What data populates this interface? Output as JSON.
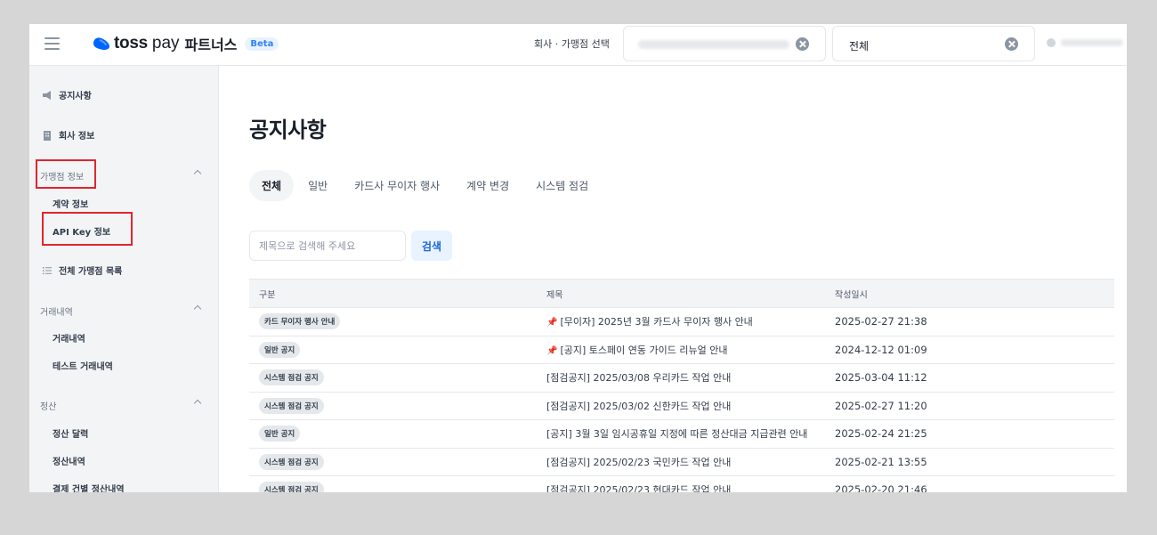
{
  "header": {
    "logo_brand": "toss",
    "logo_pay": "pay",
    "logo_partners": "파트너스",
    "beta_label": "Beta",
    "select_label": "회사 · 가맹점 선택",
    "store_select_value": "전체"
  },
  "sidebar": {
    "notice": "공지사항",
    "company_info": "회사 정보",
    "store_info_group": "가맹점 정보",
    "contract_info": "계약 정보",
    "api_key_info": "API Key 정보",
    "all_stores": "전체 가맹점 목록",
    "transactions_group": "거래내역",
    "transactions": "거래내역",
    "test_transactions": "테스트 거래내역",
    "settlement_group": "정산",
    "settlement_calendar": "정산 달력",
    "settlement_history": "정산내역",
    "payment_settlement": "결제 건별 정산내역"
  },
  "main": {
    "title": "공지사항",
    "tabs": [
      {
        "label": "전체"
      },
      {
        "label": "일반"
      },
      {
        "label": "카드사 무이자 행사"
      },
      {
        "label": "계약 변경"
      },
      {
        "label": "시스템 점검"
      }
    ],
    "search": {
      "placeholder": "제목으로 검색해 주세요",
      "button": "검색"
    },
    "table": {
      "headers": [
        "구분",
        "제목",
        "작성일시"
      ],
      "rows": [
        {
          "category": "카드 무이자 행사 안내",
          "pinned": true,
          "title": "[무이자] 2025년 3월 카드사 무이자 행사 안내",
          "date": "2025-02-27 21:38"
        },
        {
          "category": "일반 공지",
          "pinned": true,
          "title": "[공지] 토스페이 연동 가이드 리뉴얼 안내",
          "date": "2024-12-12 01:09"
        },
        {
          "category": "시스템 점검 공지",
          "pinned": false,
          "title": "[점검공지] 2025/03/08 우리카드 작업 안내",
          "date": "2025-03-04 11:12"
        },
        {
          "category": "시스템 점검 공지",
          "pinned": false,
          "title": "[점검공지] 2025/03/02 신한카드 작업 안내",
          "date": "2025-02-27 11:20"
        },
        {
          "category": "일반 공지",
          "pinned": false,
          "title": "[공지] 3월 3일 임시공휴일 지정에 따른 정산대금 지급관련 안내",
          "date": "2025-02-24 21:25"
        },
        {
          "category": "시스템 점검 공지",
          "pinned": false,
          "title": "[점검공지] 2025/02/23 국민카드 작업 안내",
          "date": "2025-02-21 13:55"
        },
        {
          "category": "시스템 점검 공지",
          "pinned": false,
          "title": "[점검공지] 2025/02/23 현대카드 작업 안내",
          "date": "2025-02-20 21:46"
        }
      ]
    }
  },
  "colors": {
    "accent": "#3182f6",
    "highlight_box": "#e0252f",
    "sidebar_bg": "#f2f4f6"
  },
  "icons": [
    "hamburger-icon",
    "toss-logo-icon",
    "clear-icon",
    "user-icon",
    "megaphone-icon",
    "building-icon",
    "list-icon",
    "chevron-up-icon",
    "pin-icon"
  ]
}
